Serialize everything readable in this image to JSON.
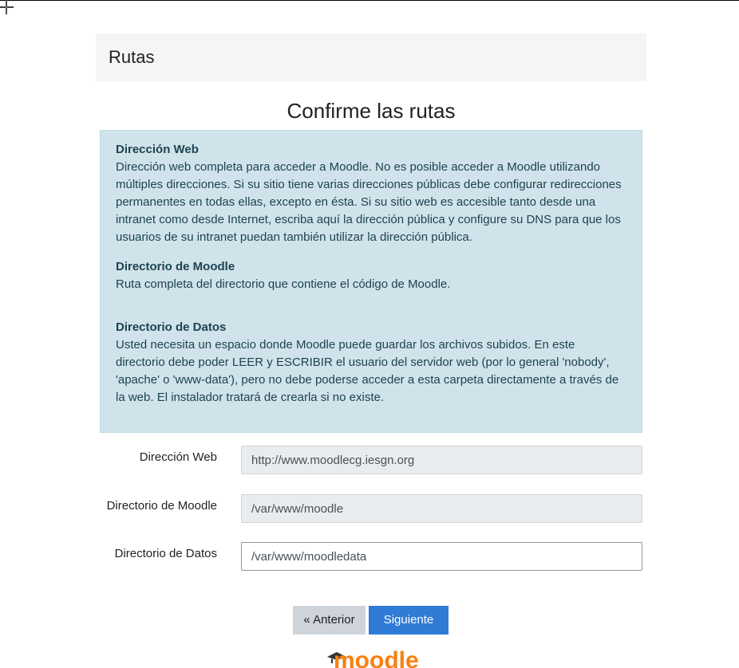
{
  "header": {
    "title": "Rutas"
  },
  "section_heading": "Confirme las rutas",
  "info": {
    "web_title": "Dirección Web",
    "web_text": "Dirección web completa para acceder a Moodle. No es posible acceder a Moodle utilizando múltiples direcciones. Si su sitio tiene varias direcciones públicas debe configurar redirecciones permanentes en todas ellas, excepto en ésta. Si su sitio web es accesible tanto desde una intranet como desde Internet, escriba aquí la dirección pública y configure su DNS para que los usuarios de su intranet puedan también utilizar la dirección pública.",
    "moodle_title": "Directorio de Moodle",
    "moodle_text": "Ruta completa del directorio que contiene el código de Moodle.",
    "data_title": "Directorio de Datos",
    "data_text": "Usted necesita un espacio donde Moodle puede guardar los archivos subidos. En este directorio debe poder LEER y ESCRIBIR el usuario del servidor web (por lo general 'nobody', 'apache' o 'www-data'), pero no debe poderse acceder a esta carpeta directamente a través de la web. El instalador tratará de crearla si no existe."
  },
  "form": {
    "web_label": "Dirección Web",
    "web_value": "http://www.moodlecg.iesgn.org",
    "moodle_label": "Directorio de Moodle",
    "moodle_value": "/var/www/moodle",
    "data_label": "Directorio de Datos",
    "data_value": "/var/www/moodledata"
  },
  "buttons": {
    "prev_label": "« Anterior",
    "next_label": "Siguiente »"
  },
  "footer": {
    "logo_text": "moodle"
  },
  "colors": {
    "info_bg": "#d1e3ea",
    "primary": "#2f7bd6",
    "logo_orange": "#f98012"
  },
  "icons": {
    "cursor": "crosshair-cursor-icon",
    "logo": "moodle-logo"
  }
}
